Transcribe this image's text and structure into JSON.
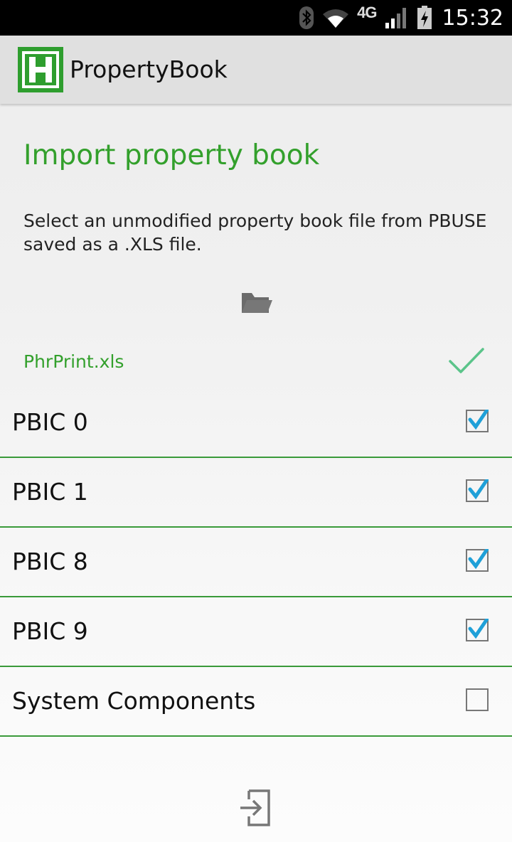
{
  "status_bar": {
    "time": "15:32",
    "network": "4G",
    "icons": [
      "bluetooth-icon",
      "wifi-icon",
      "signal-icon",
      "battery-charging-icon"
    ]
  },
  "app_bar": {
    "logo_letter": "H",
    "title": "PropertyBook"
  },
  "main": {
    "heading": "Import property book",
    "instructions": "Select an unmodified property book file from PBUSE saved as a .XLS file.",
    "selected_file": "PhrPrint.xls",
    "file_valid": true
  },
  "categories": [
    {
      "label": "PBIC 0",
      "checked": true
    },
    {
      "label": "PBIC 1",
      "checked": true
    },
    {
      "label": "PBIC 8",
      "checked": true
    },
    {
      "label": "PBIC 9",
      "checked": true
    },
    {
      "label": "System Components",
      "checked": false
    }
  ],
  "colors": {
    "accent_green": "#33a02c",
    "check_blue": "#1fa0d8",
    "divider_green": "#3a9a3a"
  }
}
